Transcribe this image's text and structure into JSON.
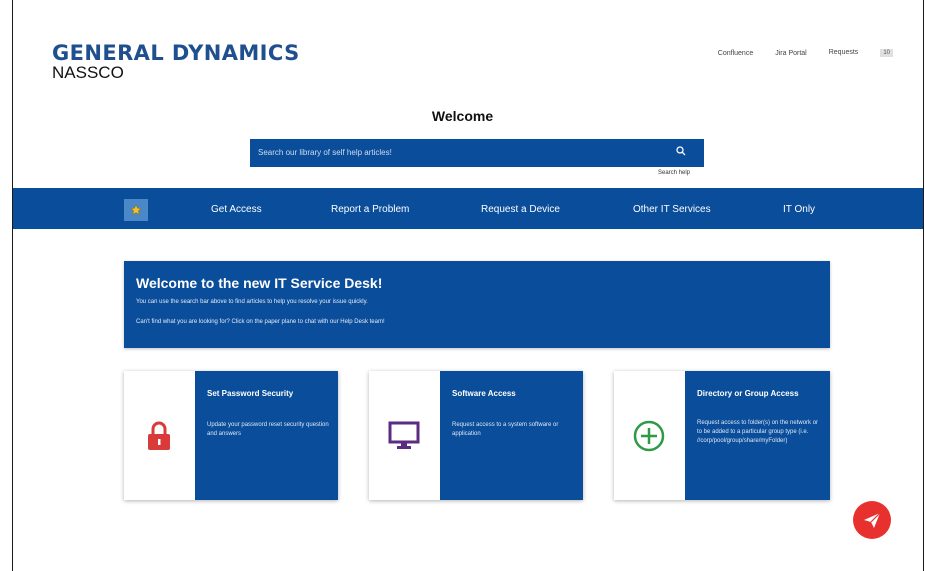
{
  "brand": {
    "line1": "GENERAL DYNAMICS",
    "line2": "NASSCO"
  },
  "top_links": {
    "confluence": "Confluence",
    "jira": "Jira Portal",
    "requests": "Requests",
    "requests_count": "10"
  },
  "welcome": "Welcome",
  "search": {
    "placeholder": "Search our library of self help articles!",
    "help": "Search help"
  },
  "nav": {
    "home_icon": "star-icon",
    "items": [
      "Get Access",
      "Report a Problem",
      "Request a Device",
      "Other IT Services",
      "IT Only"
    ]
  },
  "banner": {
    "title": "Welcome to the new IT Service Desk!",
    "line1": "You can use the search bar above to find articles to help you resolve your issue quickly.",
    "line2": "Can't find what you are looking for? Click on the paper plane to chat with our Help Desk team!"
  },
  "cards": [
    {
      "title": "Set Password Security",
      "desc": "Update your password reset security question and answers",
      "icon": "lock-icon",
      "icon_color": "#d93a3a"
    },
    {
      "title": "Software Access",
      "desc": "Request access to a system software or application",
      "icon": "monitor-icon",
      "icon_color": "#5a2d82"
    },
    {
      "title": "Directory or Group Access",
      "desc": "Request access to folder(s) on the network or to be added to a particular group type (i.e. //corp/pool/group/share/myFolder)",
      "icon": "plus-circle-icon",
      "icon_color": "#2e9a44"
    }
  ],
  "chat": {
    "icon": "paper-plane-icon",
    "color": "#e8312f"
  },
  "colors": {
    "primary": "#0a4d9a",
    "home_button": "#4b88c7",
    "brand_blue": "#1f4f8f"
  }
}
